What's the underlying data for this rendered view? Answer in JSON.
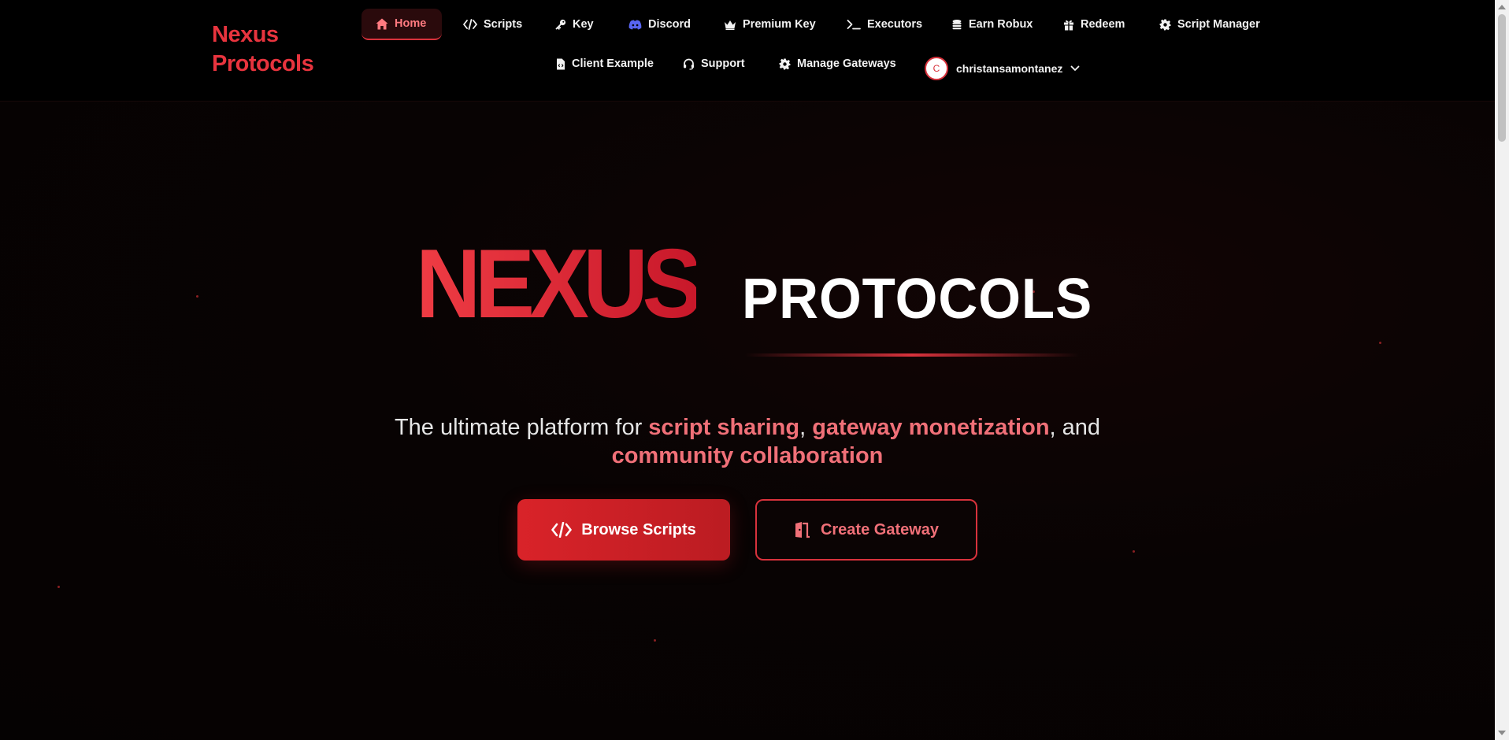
{
  "brand": {
    "line1": "Nexus",
    "line2": "Protocols"
  },
  "nav": {
    "items": [
      {
        "label": "Home",
        "icon": "home-icon",
        "active": true
      },
      {
        "label": "Scripts",
        "icon": "code-icon"
      },
      {
        "label": "Key",
        "icon": "key-icon"
      },
      {
        "label": "Discord",
        "icon": "discord-icon"
      },
      {
        "label": "Premium Key",
        "icon": "crown-icon"
      },
      {
        "label": "Executors",
        "icon": "terminal-icon"
      },
      {
        "label": "Earn Robux",
        "icon": "coins-icon"
      },
      {
        "label": "Redeem",
        "icon": "gift-icon"
      },
      {
        "label": "Script Manager",
        "icon": "gear-icon"
      },
      {
        "label": "Client Example",
        "icon": "file-code-icon"
      },
      {
        "label": "Support",
        "icon": "headset-icon"
      },
      {
        "label": "Manage Gateways",
        "icon": "gear-icon"
      }
    ],
    "user": {
      "initial": "C",
      "name": "christansamontanez"
    }
  },
  "hero": {
    "title_main": "NEXUS",
    "title_sub": "PROTOCOLS",
    "tagline": {
      "part1": "The ultimate platform for ",
      "hl1": "script sharing",
      "part2": ", ",
      "hl2": "gateway monetization",
      "part3": ", and ",
      "hl3": "community collaboration"
    },
    "primary_button": "Browse Scripts",
    "secondary_button": "Create Gateway"
  },
  "colors": {
    "accent": "#d8323c",
    "accent_light": "#f07078",
    "background": "#050202",
    "nav_bg": "#000000"
  }
}
